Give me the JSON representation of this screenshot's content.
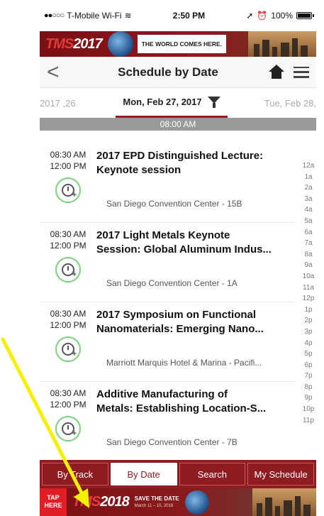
{
  "status_bar": {
    "carrier": "T-Mobile Wi-Fi",
    "time": "2:50 PM",
    "battery": "100%"
  },
  "top_banner": {
    "logo": "TMS2017",
    "logo_red": "TMS",
    "logo_white": "2017",
    "tagline": "THE WORLD COMES HERE."
  },
  "navbar": {
    "back": "<",
    "title": "Schedule by Date"
  },
  "date_bar": {
    "prev": "26, 2017",
    "current": "Mon, Feb 27, 2017",
    "next": "Tue, Feb 28,"
  },
  "time_header": "08:00 AM",
  "sessions": [
    {
      "start": "08:30 AM",
      "end": "12:00 PM",
      "title_line1": "2017 EPD Distinguished Lecture:",
      "title_line2": "Keynote session",
      "location": "San Diego Convention Center - 15B"
    },
    {
      "start": "08:30 AM",
      "end": "12:00 PM",
      "title_line1": "2017 Light Metals Keynote",
      "title_line2": "Session: Global Aluminum Indus...",
      "location": "San Diego Convention Center - 1A"
    },
    {
      "start": "08:30 AM",
      "end": "12:00 PM",
      "title_line1": "2017 Symposium on Functional",
      "title_line2": "Nanomaterials: Emerging Nano...",
      "location": "Marriott Marquis Hotel & Marina - Pacifi..."
    },
    {
      "start": "08:30 AM",
      "end": "12:00 PM",
      "title_line1": "Additive Manufacturing of",
      "title_line2": "Metals: Establishing Location-S...",
      "location": "San Diego Convention Center - 7B"
    }
  ],
  "hour_index": [
    "12a",
    "1a",
    "2a",
    "3a",
    "4a",
    "5a",
    "6a",
    "7a",
    "8a",
    "9a",
    "10a",
    "11a",
    "12p",
    "1p",
    "2p",
    "3p",
    "4p",
    "5p",
    "6p",
    "7p",
    "8p",
    "9p",
    "10p",
    "11p"
  ],
  "tabs": [
    {
      "label": "By Track",
      "active": false
    },
    {
      "label": "By Date",
      "active": true
    },
    {
      "label": "Search",
      "active": false
    },
    {
      "label": "My Schedule",
      "active": false
    }
  ],
  "bottom_banner": {
    "tap_line1": "TAP",
    "tap_line2": "HERE",
    "logo_red": "TMS",
    "logo_white": "2018",
    "save_the_date": "SAVE THE DATE",
    "dates": "March 11 – 15, 2018"
  },
  "colors": {
    "brand_red": "#8f1c21",
    "alarm_green": "#7ed07e",
    "annotation_yellow": "#f5f000"
  }
}
